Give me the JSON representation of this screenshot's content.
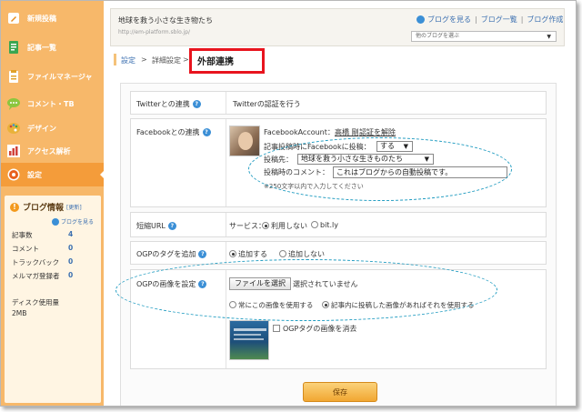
{
  "sidebar": {
    "items": [
      {
        "label": "新規投稿",
        "icon": "pencil-icon",
        "color": "#e58a1a"
      },
      {
        "label": "記事一覧",
        "icon": "document-icon",
        "color": "#3aa650"
      },
      {
        "label": "ファイルマネージャ",
        "icon": "clipboard-icon",
        "color": "#e0a22a"
      },
      {
        "label": "コメント・TB",
        "icon": "comment-icon",
        "color": "#8cc63e"
      },
      {
        "label": "デザイン",
        "icon": "palette-icon",
        "color": "#e9b23a"
      },
      {
        "label": "アクセス解析",
        "icon": "bar-chart-icon",
        "color": "#d0413a"
      },
      {
        "label": "設定",
        "icon": "gear-icon",
        "color": "#f3a43a"
      }
    ],
    "active_index": 6
  },
  "blog_info": {
    "title": "ブログ情報",
    "update_link": "[更新]",
    "view_blog_link": "ブログを見る",
    "stats": [
      {
        "label": "記事数",
        "value": "4"
      },
      {
        "label": "コメント",
        "value": "0"
      },
      {
        "label": "トラックバック",
        "value": "0"
      },
      {
        "label": "メルマガ登録者",
        "value": "0"
      }
    ],
    "disk_label": "ディスク使用量",
    "disk_value": "2MB"
  },
  "header": {
    "blog_title": "地球を救う小さな生き物たち",
    "blog_url": "http://em-platform.sblo.jp/",
    "links": [
      "ブログを見る",
      "ブログ一覧",
      "ブログ作成"
    ],
    "other_blog_select": "他のブログを選ぶ"
  },
  "breadcrumb": {
    "items": [
      "設定",
      "詳細設定",
      "外部連携"
    ],
    "separator": ">"
  },
  "settings": {
    "twitter": {
      "label": "Twitterとの連携",
      "link": "Twitterの認証を行う"
    },
    "facebook": {
      "label": "Facebookとの連携",
      "account_label": "FacebookAccount：",
      "account_name": "高橋 剛",
      "reauth_link": "認証を解除",
      "post_on_publish_label": "記事投稿時にFacebookに投稿：",
      "post_on_publish_value": "する",
      "target_label": "投稿先：",
      "target_value": "地球を救う小さな生きものたち",
      "comment_label": "投稿時のコメント：",
      "comment_value": "これはブログからの自動投稿です。",
      "comment_hint": "※250文字以内で入力してください"
    },
    "short_url": {
      "label": "短縮URL",
      "service_label": "サービス：",
      "options": [
        "利用しない",
        "bit.ly"
      ],
      "selected_index": 0
    },
    "ogp_tag": {
      "label": "OGPのタグを追加",
      "options": [
        "追加する",
        "追加しない"
      ],
      "selected_index": 0
    },
    "ogp_image": {
      "label": "OGPの画像を設定",
      "file_button": "ファイルを選択",
      "file_status": "選択されていません",
      "options": [
        "常にこの画像を使用する",
        "記事内に投稿した画像があればそれを使用する"
      ],
      "selected_index": 1,
      "delete_checkbox_label": "OGPタグの画像を消去"
    }
  },
  "save_button": "保存",
  "colors": {
    "sidebar_bg": "#f7b86a",
    "sidebar_active": "#f49c3a",
    "link": "#3b6fb0",
    "highlight_box": "#e8141e",
    "dashed_ellipse": "#1f9bc0",
    "save_button": "#f1a732"
  }
}
